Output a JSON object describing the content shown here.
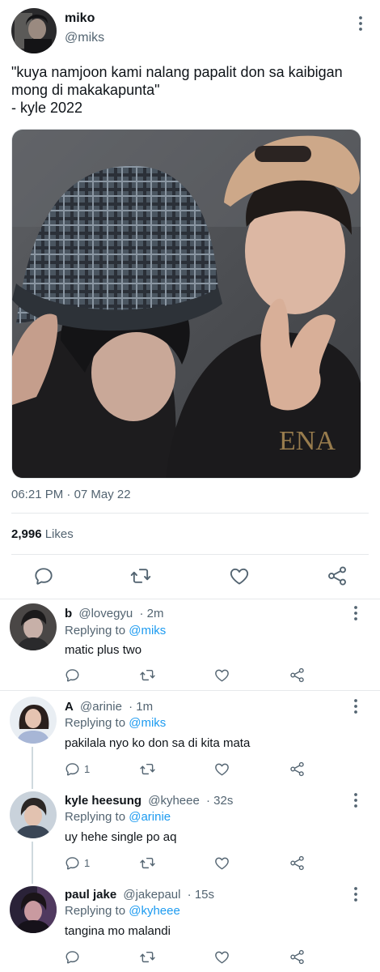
{
  "tweet": {
    "author_name": "miko",
    "author_handle": "@miks",
    "text": "\"kuya namjoon kami nalang papalit don sa kaibigan mong di makakapunta\"\n- kyle 2022",
    "time": "06:21 PM",
    "separator": "·",
    "date": "07 May 22",
    "likes_count": "2,996",
    "likes_label": "Likes"
  },
  "replies": [
    {
      "name": "b",
      "handle": "@lovegyu",
      "time": "· 2m",
      "replying_label": "Replying to",
      "replying_to": "@miks",
      "text": "matic plus two",
      "reply_count": ""
    },
    {
      "name": "A",
      "handle": "@arinie",
      "time": "· 1m",
      "replying_label": "Replying to",
      "replying_to": "@miks",
      "text": "pakilala nyo ko don sa di kita mata",
      "reply_count": "1"
    },
    {
      "name": "kyle heesung",
      "handle": "@kyheee",
      "time": "· 32s",
      "replying_label": "Replying to",
      "replying_to": "@arinie",
      "text": "uy hehe single po aq",
      "reply_count": "1"
    },
    {
      "name": "paul jake",
      "handle": "@jakepaul",
      "time": "· 15s",
      "replying_label": "Replying to",
      "replying_to": "@kyheee",
      "text": "tangina mo malandi",
      "reply_count": ""
    }
  ],
  "icons": {
    "reply": "reply-icon",
    "retweet": "retweet-icon",
    "like": "heart-icon",
    "share": "share-icon",
    "more": "more-icon"
  },
  "colors": {
    "text_primary": "#0f1419",
    "text_secondary": "#536471",
    "link": "#1d9bf0",
    "divider": "#e6e9eb"
  }
}
